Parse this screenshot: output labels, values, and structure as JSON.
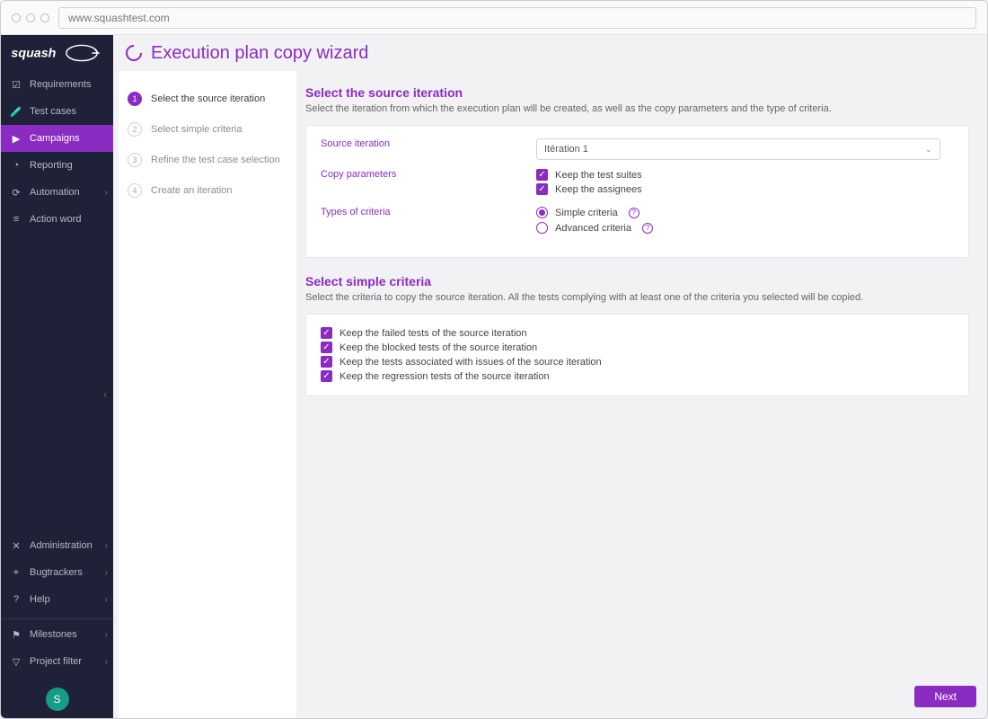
{
  "browser": {
    "url": "www.squashtest.com"
  },
  "page_title": "Execution plan copy wizard",
  "sidebar": {
    "items": [
      {
        "label": "Requirements"
      },
      {
        "label": "Test cases"
      },
      {
        "label": "Campaigns"
      },
      {
        "label": "Reporting"
      },
      {
        "label": "Automation"
      },
      {
        "label": "Action word"
      }
    ],
    "footer_items": [
      {
        "label": "Administration"
      },
      {
        "label": "Bugtrackers"
      },
      {
        "label": "Help"
      },
      {
        "label": "Milestones"
      },
      {
        "label": "Project filter"
      }
    ],
    "avatar": "S"
  },
  "steps": [
    {
      "num": "1",
      "label": "Select the source iteration"
    },
    {
      "num": "2",
      "label": "Select simple criteria"
    },
    {
      "num": "3",
      "label": "Refine the test case selection"
    },
    {
      "num": "4",
      "label": "Create an iteration"
    }
  ],
  "section1": {
    "title": "Select the source iteration",
    "desc": "Select the iteration from which the execution plan will be created, as well as the copy parameters and the type of criteria.",
    "fields": {
      "source": {
        "label": "Source iteration",
        "value": "Itération 1"
      },
      "copy": {
        "label": "Copy parameters",
        "opts": [
          "Keep the test suites",
          "Keep the assignees"
        ]
      },
      "types": {
        "label": "Types of criteria",
        "opts": [
          "Simple criteria",
          "Advanced criteria"
        ]
      }
    }
  },
  "section2": {
    "title": "Select simple criteria",
    "desc": "Select the criteria to copy the source iteration. All the tests complying with at least one of the criteria you selected will be copied.",
    "checks": [
      "Keep the failed tests of the source iteration",
      "Keep the blocked tests of the source iteration",
      "Keep the tests associated with issues of the source iteration",
      "Keep the regression tests of the source iteration"
    ]
  },
  "next": "Next"
}
